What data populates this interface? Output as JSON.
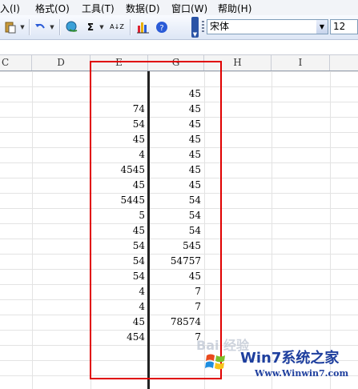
{
  "menu": [
    "入(I)",
    "格式(O)",
    "工具(T)",
    "数据(D)",
    "窗口(W)",
    "帮助(H)"
  ],
  "toolbar": {
    "sigma_label": "Σ",
    "sort_label": "A↓Z",
    "font_name": "宋体",
    "font_size": "12"
  },
  "columns": [
    "C",
    "D",
    "E",
    "G",
    "H",
    "I"
  ],
  "column_E": [
    "",
    "74",
    "54",
    "45",
    "4",
    "4545",
    "45",
    "5445",
    "5",
    "45",
    "54",
    "54",
    "54",
    "4",
    "4",
    "45",
    "454"
  ],
  "column_G": [
    "45",
    "45",
    "45",
    "45",
    "45",
    "45",
    "45",
    "54",
    "54",
    "54",
    "545",
    "54757",
    "45",
    "7",
    "7",
    "78574",
    "7"
  ],
  "watermark": {
    "baidu_text": "Bai 经验",
    "logo_text": "Win7系统之家",
    "url": "Www.Winwin7.com"
  },
  "colors": {
    "highlight_border": "#e00000",
    "cell_border": "#222222"
  }
}
